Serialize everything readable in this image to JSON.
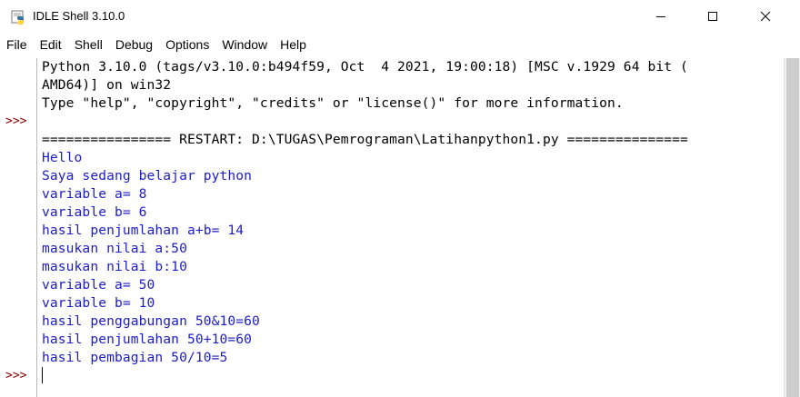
{
  "window": {
    "title": "IDLE Shell 3.10.0",
    "icon": "python-idle-icon"
  },
  "menu": [
    "File",
    "Edit",
    "Shell",
    "Debug",
    "Options",
    "Window",
    "Help"
  ],
  "shell": {
    "prompt": ">>>",
    "lines": [
      {
        "text": "Python 3.10.0 (tags/v3.10.0:b494f59, Oct  4 2021, 19:00:18) [MSC v.1929 64 bit (",
        "color": "black"
      },
      {
        "text": "AMD64)] on win32",
        "color": "black"
      },
      {
        "text": "Type \"help\", \"copyright\", \"credits\" or \"license()\" for more information.",
        "color": "black"
      },
      {
        "text": "",
        "color": "black"
      },
      {
        "text": "================ RESTART: D:\\TUGAS\\Pemrograman\\Latihanpython1.py ===============",
        "color": "black"
      },
      {
        "text": "Hello",
        "color": "blue"
      },
      {
        "text": "Saya sedang belajar python",
        "color": "blue"
      },
      {
        "text": "variable a= 8",
        "color": "blue"
      },
      {
        "text": "variable b= 6",
        "color": "blue"
      },
      {
        "text": "hasil penjumlahan a+b= 14",
        "color": "blue"
      },
      {
        "text": "masukan nilai a:50",
        "color": "blue"
      },
      {
        "text": "masukan nilai b:10",
        "color": "blue"
      },
      {
        "text": "variable a= 50",
        "color": "blue"
      },
      {
        "text": "variable b= 10",
        "color": "blue"
      },
      {
        "text": "hasil penggabungan 50&10=60",
        "color": "blue"
      },
      {
        "text": "hasil penjumlahan 50+10=60",
        "color": "blue"
      },
      {
        "text": "hasil pembagian 50/10=5",
        "color": "blue"
      },
      {
        "text": "",
        "color": "black"
      }
    ]
  },
  "colors": {
    "prompt": "#8b0000",
    "stdout": "#0000ff",
    "text": "#000000"
  }
}
